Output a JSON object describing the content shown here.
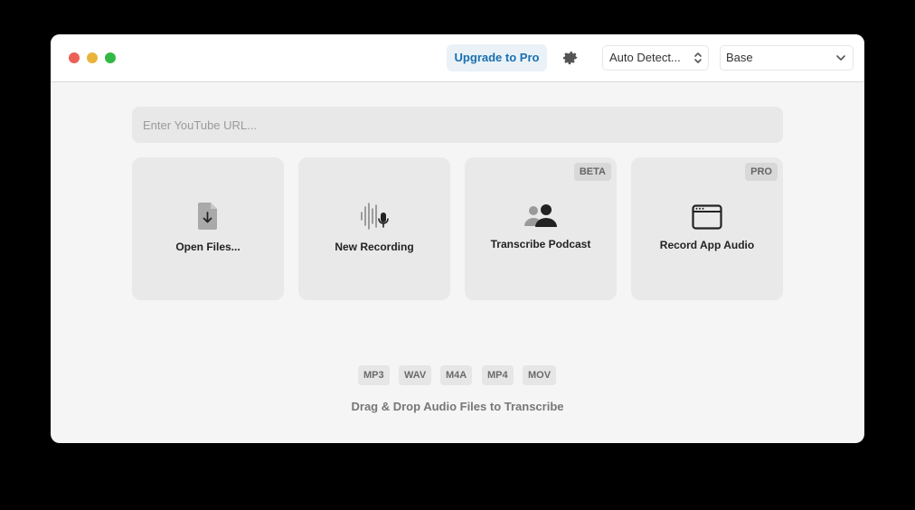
{
  "toolbar": {
    "upgrade_label": "Upgrade to Pro",
    "settings_icon": "gear-icon",
    "language": "Auto Detect...",
    "model": "Base"
  },
  "url_input": {
    "placeholder": "Enter YouTube URL..."
  },
  "actions": [
    {
      "label": "Open Files...",
      "icon": "document-download-icon"
    },
    {
      "label": "New Recording",
      "icon": "waveform-microphone-icon"
    },
    {
      "label": "Transcribe Podcast",
      "icon": "people-icon",
      "badge": "BETA"
    },
    {
      "label": "Record App Audio",
      "icon": "app-window-icon",
      "badge": "PRO"
    }
  ],
  "formats": [
    "MP3",
    "WAV",
    "M4A",
    "MP4",
    "MOV"
  ],
  "drop_text": "Drag & Drop Audio Files to Transcribe",
  "colors": {
    "accent": "#1a6fb0",
    "close": "#ec5f57",
    "minimize": "#e9b43b",
    "maximize": "#33b845"
  }
}
